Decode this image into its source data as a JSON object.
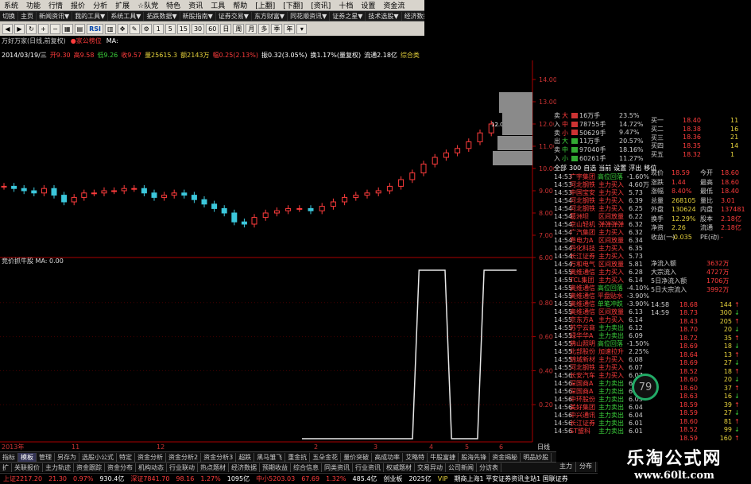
{
  "menu": [
    "系统",
    "功能",
    "行情",
    "报价",
    "分析",
    "扩展",
    "☆队党",
    "特色",
    "资讯",
    "工具",
    "帮助",
    "[上翻]",
    "[下翻]",
    "[资讯]",
    "十档",
    "设置",
    "资金流"
  ],
  "nav": [
    "切换",
    "主页",
    "新闻资讯▼",
    "我的工具▼",
    "系统工具▼",
    "拓跌数据▼",
    "新股指南▼",
    "证券交易▼",
    "东方财富▼",
    "同花顺资讯▼",
    "证券之星▼",
    "技术选股▼",
    "经济数据▼",
    "论坛聊天"
  ],
  "toolbar": [
    "1",
    "5",
    "15",
    "30",
    "60",
    "日",
    "周",
    "月",
    "多",
    "季",
    "年"
  ],
  "chart_header": {
    "name": "万好万家(日线,前复权)",
    "indicator": "家公榜位",
    "ma": "MA:"
  },
  "quote_line": {
    "date": "2014/03/19/三",
    "open": "开9.30",
    "high": "高9.58",
    "low": "低9.26",
    "close": "收9.57",
    "volume": "量25615.3",
    "amount": "额2143万",
    "change": "幅0.25(2.13%)",
    "amplitude": "振0.32(3.05%)",
    "turnover": "换1.17%(量复权)",
    "float": "流通2.18亿",
    "tag": "综合类"
  },
  "sub_indicator": {
    "label": "竞价抓牛股",
    "ma": "MA:",
    "val": "0.00"
  },
  "price_axis": [
    "14.00",
    "13.00",
    "12.00",
    "11.00",
    "10.00",
    "9.00",
    "8.00",
    "7.00",
    "6.00"
  ],
  "sub_axis": [
    "0.80",
    "0.60",
    "0.40",
    "0.20"
  ],
  "x_axis": [
    "2013年",
    "11",
    "12",
    "2",
    "3",
    "4",
    "5",
    "6"
  ],
  "last_price_label": "12.00 - 12.",
  "chart_data": {
    "type": "line",
    "series": [
      {
        "values": [
          9.2,
          9.1,
          9.0,
          8.9,
          9.1,
          8.8,
          8.5,
          8.7,
          8.9,
          8.9,
          9.0,
          9.0,
          9.1,
          9.1,
          8.9,
          8.7,
          8.8,
          8.9,
          8.8,
          8.6,
          8.4,
          8.2,
          8.0,
          7.6,
          7.5,
          7.8,
          8.0,
          8.1,
          8.2,
          8.2,
          8.1,
          8.3,
          8.5,
          8.7,
          8.8,
          8.9,
          9.0,
          9.2,
          9.5,
          9.8,
          10.2,
          10.5,
          10.7,
          10.9,
          11.2,
          11.6,
          12.0
        ]
      },
      {
        "values": [
          0,
          0,
          0,
          0,
          0,
          0,
          0,
          0,
          0,
          0,
          0,
          0,
          0,
          0,
          0,
          0,
          0,
          0,
          1,
          1,
          1,
          1,
          1,
          0,
          0,
          0,
          0,
          0,
          1,
          1,
          1,
          1,
          1,
          1
        ]
      }
    ],
    "ylim": [
      6,
      14.5
    ]
  },
  "order_book": [
    {
      "k": "买一",
      "p": "18.40",
      "v": "11"
    },
    {
      "k": "买二",
      "p": "18.38",
      "v": "16"
    },
    {
      "k": "买三",
      "p": "18.36",
      "v": "21"
    },
    {
      "k": "买四",
      "p": "18.35",
      "v": "14"
    },
    {
      "k": "买五",
      "p": "18.32",
      "v": "1"
    }
  ],
  "flow": [
    {
      "k": "大",
      "v": "16万手",
      "pct": "23.5%"
    },
    {
      "k": "中",
      "v": "78755手",
      "pct": "14.72%"
    },
    {
      "k": "小",
      "v": "50629手",
      "pct": "9.47%"
    },
    {
      "k": "大",
      "v": "11万手",
      "pct": "20.57%"
    },
    {
      "k": "中",
      "v": "97040手",
      "pct": "18.16%"
    },
    {
      "k": "小",
      "v": "60261手",
      "pct": "11.27%"
    }
  ],
  "flow_side": [
    "卖",
    "入",
    "卖",
    "出"
  ],
  "board_tabs": [
    "全部",
    "300",
    "自选",
    "当前",
    "设置",
    "浮出",
    "移位"
  ],
  "news": [
    {
      "t": "14:53",
      "n": "广宇集团",
      "a": "高位回落",
      "v": "-1.60%"
    },
    {
      "t": "14:53",
      "n": "河北钢铁",
      "a": "主力买入",
      "v": "4.60万"
    },
    {
      "t": "14:53",
      "n": "中国宝安",
      "a": "主力买入",
      "v": "5.73"
    },
    {
      "t": "14:54",
      "n": "河北钢铁",
      "a": "主力买入",
      "v": "6.39"
    },
    {
      "t": "14:54",
      "n": "河北钢铁",
      "a": "主力买入",
      "v": "6.25"
    },
    {
      "t": "14:54",
      "n": "葛洲坝",
      "a": "区间放量",
      "v": "6.22"
    },
    {
      "t": "14:54",
      "n": "京山轻机",
      "a": "弹弹弹弹",
      "v": "6.32"
    },
    {
      "t": "14:54",
      "n": "广汽集团",
      "a": "主力买入",
      "v": "6.32"
    },
    {
      "t": "14:54",
      "n": "粤电力A",
      "a": "区间放量",
      "v": "6.34"
    },
    {
      "t": "14:54",
      "n": "丹化科技",
      "a": "主力买入",
      "v": "6.35"
    },
    {
      "t": "14:54",
      "n": "长江证券",
      "a": "主力买入",
      "v": "5.73"
    },
    {
      "t": "14:54",
      "n": "万和电气",
      "a": "区间放量",
      "v": "5.81"
    },
    {
      "t": "14:55",
      "n": "奥维通信",
      "a": "主力买入",
      "v": "6.28"
    },
    {
      "t": "14:55",
      "n": "TCL集团",
      "a": "主力买入",
      "v": "6.14"
    },
    {
      "t": "14:55",
      "n": "奥维通信",
      "a": "高位回落",
      "v": "-4.10%"
    },
    {
      "t": "14:55",
      "n": "奥维通信",
      "a": "平盘贴水",
      "v": "-3.90%"
    },
    {
      "t": "14:55",
      "n": "奥维通信",
      "a": "单笔冲跌",
      "v": "-3.90%"
    },
    {
      "t": "14:55",
      "n": "奥维通信",
      "a": "区间放量",
      "v": "6.13"
    },
    {
      "t": "14:55",
      "n": "京东方A",
      "a": "主力买入",
      "v": "6.14"
    },
    {
      "t": "14:55",
      "n": "苏宁云商",
      "a": "主力卖出",
      "v": "6.12"
    },
    {
      "t": "14:55",
      "n": "绿华华A",
      "a": "主力卖出",
      "v": "6.09"
    },
    {
      "t": "14:55",
      "n": "佛山照明",
      "a": "高位回落",
      "v": "-1.50%"
    },
    {
      "t": "14:55",
      "n": "北部股份",
      "a": "加速拉升",
      "v": "2.25%"
    },
    {
      "t": "14:55",
      "n": "锦城新材",
      "a": "主力买入",
      "v": "6.08"
    },
    {
      "t": "14:55",
      "n": "河北钢铁",
      "a": "主力买入",
      "v": "6.07"
    },
    {
      "t": "14:56",
      "n": "长安汽车",
      "a": "主力买入",
      "v": "6.07"
    },
    {
      "t": "14:56",
      "n": "深国商A",
      "a": "主力卖出",
      "v": "6.07"
    },
    {
      "t": "14:56",
      "n": "深国商A",
      "a": "主力卖出",
      "v": "6.05"
    },
    {
      "t": "14:56",
      "n": "中环股份",
      "a": "主力卖出",
      "v": "6.05"
    },
    {
      "t": "14:56",
      "n": "美好集团",
      "a": "主力卖出",
      "v": "6.04"
    },
    {
      "t": "14:56",
      "n": "中兴通讯",
      "a": "主力卖出",
      "v": "6.04"
    },
    {
      "t": "14:56",
      "n": "长江证券",
      "a": "主力卖出",
      "v": "6.01"
    },
    {
      "t": "14:56",
      "n": "ST盟科",
      "a": "主力卖出",
      "v": "6.01"
    }
  ],
  "stats": [
    {
      "k": "现价",
      "v": "18.59",
      "k2": "今开",
      "v2": "18.60"
    },
    {
      "k": "涨跌",
      "v": "1.44",
      "k2": "最高",
      "v2": "18.60"
    },
    {
      "k": "涨幅",
      "v": "8.40%",
      "k2": "最低",
      "v2": "18.40"
    },
    {
      "k": "总量",
      "v": "268105",
      "k2": "量比",
      "v2": "3.01"
    },
    {
      "k": "外盘",
      "v": "130624",
      "k2": "内盘",
      "v2": "137481"
    },
    {
      "k": "换手",
      "v": "12.29%",
      "k2": "股本",
      "v2": "2.18亿"
    },
    {
      "k": "净资",
      "v": "2.26",
      "k2": "流通",
      "v2": "2.18亿"
    },
    {
      "k": "收益(一)",
      "v": "-0.035",
      "k2": "PE(动)",
      "v2": "-"
    }
  ],
  "money_flow": [
    {
      "k": "净流入额",
      "v": "3632万"
    },
    {
      "k": "大宗流入",
      "v": "4727万"
    },
    {
      "k": "5日净流入额",
      "v": "1706万"
    },
    {
      "k": "5日大宗流入",
      "v": "3992万"
    }
  ],
  "ticks": [
    {
      "t": "14:58",
      "p": "18.68",
      "v": "144"
    },
    {
      "t": "14:59",
      "p": "18.73",
      "v": "300"
    },
    {
      "t": "",
      "p": "18.43",
      "v": "205"
    },
    {
      "t": "",
      "p": "18.70",
      "v": "20"
    },
    {
      "t": "",
      "p": "18.72",
      "v": "35"
    },
    {
      "t": "",
      "p": "18.69",
      "v": "18"
    },
    {
      "t": "",
      "p": "18.64",
      "v": "13"
    },
    {
      "t": "",
      "p": "18.69",
      "v": "27"
    },
    {
      "t": "",
      "p": "18.52",
      "v": "18"
    },
    {
      "t": "",
      "p": "18.60",
      "v": "20"
    },
    {
      "t": "",
      "p": "18.60",
      "v": "37"
    },
    {
      "t": "",
      "p": "18.63",
      "v": "16"
    },
    {
      "t": "",
      "p": "18.59",
      "v": "39"
    },
    {
      "t": "",
      "p": "18.59",
      "v": "27"
    },
    {
      "t": "",
      "p": "18.60",
      "v": "81"
    },
    {
      "t": "",
      "p": "18.52",
      "v": "99"
    },
    {
      "t": "",
      "p": "18.59",
      "v": "160"
    }
  ],
  "progress_circle": "79",
  "bottom_tabs": [
    "指标",
    "模板",
    "管理",
    "另存为",
    "选股小公式",
    "特定",
    "资金分析",
    "资金分析2",
    "资金分析3",
    "超跌",
    "黑马雏飞",
    "重金抗",
    "五朵金花",
    "量价突破",
    "高成功率",
    "艾略特",
    "牛股富捷",
    "股海先锋",
    "资金揭秘",
    "明品妙股"
  ],
  "bottom_tabs2": [
    "扩",
    "关联报价",
    "主力轨迹",
    "资金跟踪",
    "资金分布",
    "机构动态",
    "行业联动",
    "热点题材",
    "经济数据",
    "预期收益",
    "综合信息",
    "同类资讯",
    "行业资讯",
    "权威题材",
    "交易异动",
    "公司新闻",
    "分访表"
  ],
  "right_label": "日线",
  "right_tabs": [
    "主力",
    "分布"
  ],
  "status": {
    "shz": "上证2217.20",
    "shz_chg": "21.30",
    "shz_pct": "0.97%",
    "shz_amt": "930.4亿",
    "sz": "深证7841.70",
    "sz_chg": "98.16",
    "sz_pct": "1.27%",
    "sz_amt": "1095亿",
    "zx": "中小5203.03",
    "zx_chg": "67.69",
    "zx_pct": "1.32%",
    "zx_amt": "485.4亿",
    "cy": "创业板",
    "cy_amt": "2025亿",
    "misc": "VIP",
    "ticker": "期商上海1 平安证券资讯主站1 国联证券"
  },
  "watermark": {
    "title": "乐淘公式网",
    "url": "www.60lt.com"
  }
}
